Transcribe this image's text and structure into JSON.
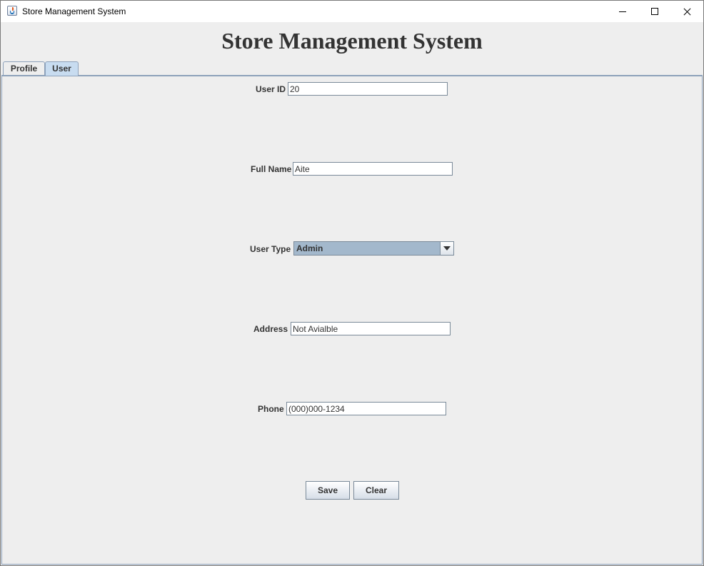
{
  "window": {
    "title": "Store Management System"
  },
  "header": {
    "title": "Store Management System"
  },
  "tabs": [
    {
      "label": "Profile",
      "selected": false
    },
    {
      "label": "User",
      "selected": true
    }
  ],
  "form": {
    "user_id": {
      "label": "User ID",
      "value": "20"
    },
    "full_name": {
      "label": "Full Name",
      "value": "Aite"
    },
    "user_type": {
      "label": "User Type",
      "value": "Admin"
    },
    "address": {
      "label": "Address",
      "value": "Not Avialble"
    },
    "phone": {
      "label": "Phone",
      "value": "(000)000-1234"
    }
  },
  "buttons": {
    "save": "Save",
    "clear": "Clear"
  },
  "colors": {
    "selected_tab": "#c8dcf0",
    "combo_background": "#a3b8cc",
    "panel_background": "#eeeeee"
  },
  "icons": {
    "app": "java-cup-icon",
    "minimize": "minimize-icon",
    "maximize": "maximize-icon",
    "close": "close-icon",
    "dropdown": "chevron-down-icon"
  }
}
